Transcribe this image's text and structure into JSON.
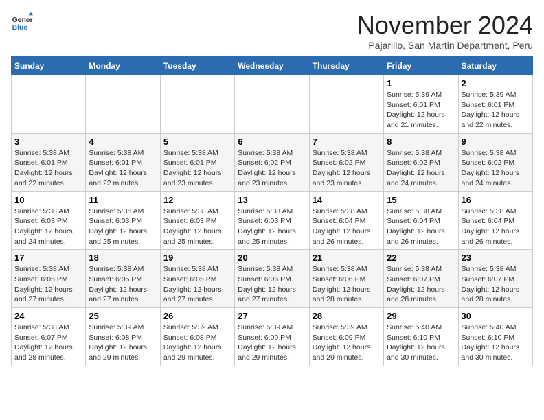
{
  "header": {
    "logo_general": "General",
    "logo_blue": "Blue",
    "month_title": "November 2024",
    "subtitle": "Pajarillo, San Martin Department, Peru"
  },
  "days_of_week": [
    "Sunday",
    "Monday",
    "Tuesday",
    "Wednesday",
    "Thursday",
    "Friday",
    "Saturday"
  ],
  "weeks": [
    [
      {
        "day": "",
        "info": ""
      },
      {
        "day": "",
        "info": ""
      },
      {
        "day": "",
        "info": ""
      },
      {
        "day": "",
        "info": ""
      },
      {
        "day": "",
        "info": ""
      },
      {
        "day": "1",
        "info": "Sunrise: 5:39 AM\nSunset: 6:01 PM\nDaylight: 12 hours and 21 minutes."
      },
      {
        "day": "2",
        "info": "Sunrise: 5:39 AM\nSunset: 6:01 PM\nDaylight: 12 hours and 22 minutes."
      }
    ],
    [
      {
        "day": "3",
        "info": "Sunrise: 5:38 AM\nSunset: 6:01 PM\nDaylight: 12 hours and 22 minutes."
      },
      {
        "day": "4",
        "info": "Sunrise: 5:38 AM\nSunset: 6:01 PM\nDaylight: 12 hours and 22 minutes."
      },
      {
        "day": "5",
        "info": "Sunrise: 5:38 AM\nSunset: 6:01 PM\nDaylight: 12 hours and 23 minutes."
      },
      {
        "day": "6",
        "info": "Sunrise: 5:38 AM\nSunset: 6:02 PM\nDaylight: 12 hours and 23 minutes."
      },
      {
        "day": "7",
        "info": "Sunrise: 5:38 AM\nSunset: 6:02 PM\nDaylight: 12 hours and 23 minutes."
      },
      {
        "day": "8",
        "info": "Sunrise: 5:38 AM\nSunset: 6:02 PM\nDaylight: 12 hours and 24 minutes."
      },
      {
        "day": "9",
        "info": "Sunrise: 5:38 AM\nSunset: 6:02 PM\nDaylight: 12 hours and 24 minutes."
      }
    ],
    [
      {
        "day": "10",
        "info": "Sunrise: 5:38 AM\nSunset: 6:03 PM\nDaylight: 12 hours and 24 minutes."
      },
      {
        "day": "11",
        "info": "Sunrise: 5:38 AM\nSunset: 6:03 PM\nDaylight: 12 hours and 25 minutes."
      },
      {
        "day": "12",
        "info": "Sunrise: 5:38 AM\nSunset: 6:03 PM\nDaylight: 12 hours and 25 minutes."
      },
      {
        "day": "13",
        "info": "Sunrise: 5:38 AM\nSunset: 6:03 PM\nDaylight: 12 hours and 25 minutes."
      },
      {
        "day": "14",
        "info": "Sunrise: 5:38 AM\nSunset: 6:04 PM\nDaylight: 12 hours and 26 minutes."
      },
      {
        "day": "15",
        "info": "Sunrise: 5:38 AM\nSunset: 6:04 PM\nDaylight: 12 hours and 26 minutes."
      },
      {
        "day": "16",
        "info": "Sunrise: 5:38 AM\nSunset: 6:04 PM\nDaylight: 12 hours and 26 minutes."
      }
    ],
    [
      {
        "day": "17",
        "info": "Sunrise: 5:38 AM\nSunset: 6:05 PM\nDaylight: 12 hours and 27 minutes."
      },
      {
        "day": "18",
        "info": "Sunrise: 5:38 AM\nSunset: 6:05 PM\nDaylight: 12 hours and 27 minutes."
      },
      {
        "day": "19",
        "info": "Sunrise: 5:38 AM\nSunset: 6:05 PM\nDaylight: 12 hours and 27 minutes."
      },
      {
        "day": "20",
        "info": "Sunrise: 5:38 AM\nSunset: 6:06 PM\nDaylight: 12 hours and 27 minutes."
      },
      {
        "day": "21",
        "info": "Sunrise: 5:38 AM\nSunset: 6:06 PM\nDaylight: 12 hours and 28 minutes."
      },
      {
        "day": "22",
        "info": "Sunrise: 5:38 AM\nSunset: 6:07 PM\nDaylight: 12 hours and 28 minutes."
      },
      {
        "day": "23",
        "info": "Sunrise: 5:38 AM\nSunset: 6:07 PM\nDaylight: 12 hours and 28 minutes."
      }
    ],
    [
      {
        "day": "24",
        "info": "Sunrise: 5:38 AM\nSunset: 6:07 PM\nDaylight: 12 hours and 28 minutes."
      },
      {
        "day": "25",
        "info": "Sunrise: 5:39 AM\nSunset: 6:08 PM\nDaylight: 12 hours and 29 minutes."
      },
      {
        "day": "26",
        "info": "Sunrise: 5:39 AM\nSunset: 6:08 PM\nDaylight: 12 hours and 29 minutes."
      },
      {
        "day": "27",
        "info": "Sunrise: 5:39 AM\nSunset: 6:09 PM\nDaylight: 12 hours and 29 minutes."
      },
      {
        "day": "28",
        "info": "Sunrise: 5:39 AM\nSunset: 6:09 PM\nDaylight: 12 hours and 29 minutes."
      },
      {
        "day": "29",
        "info": "Sunrise: 5:40 AM\nSunset: 6:10 PM\nDaylight: 12 hours and 30 minutes."
      },
      {
        "day": "30",
        "info": "Sunrise: 5:40 AM\nSunset: 6:10 PM\nDaylight: 12 hours and 30 minutes."
      }
    ]
  ]
}
